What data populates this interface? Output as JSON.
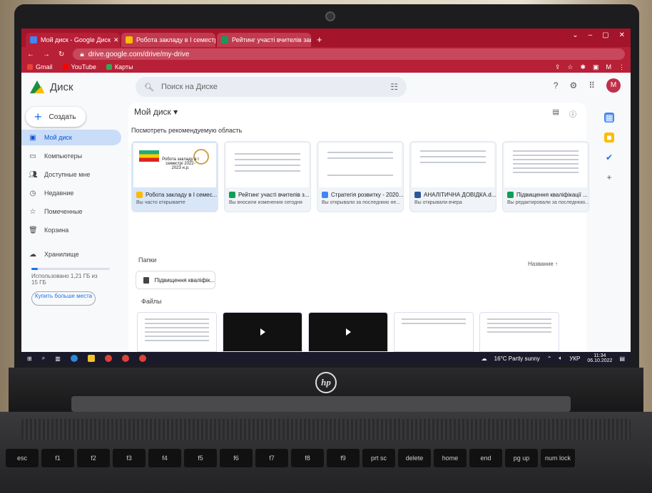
{
  "browser": {
    "tabs": [
      {
        "label": "Мой диск - Google Диск",
        "icon": "google-drive-icon",
        "color": "#4285f4"
      },
      {
        "label": "Робота закладу в I семестрі 20...",
        "icon": "slides-icon",
        "color": "#fbbc04"
      },
      {
        "label": "Рейтинг участі вчителів заклад...",
        "icon": "sheets-icon",
        "color": "#0f9d58"
      }
    ],
    "url": "drive.google.com/drive/my-drive",
    "bookmarks": [
      {
        "label": "Gmail",
        "color": "#ea4335"
      },
      {
        "label": "YouTube",
        "color": "#ff0000"
      },
      {
        "label": "Карты",
        "color": "#34a853"
      }
    ],
    "accent": "#b82037"
  },
  "drive": {
    "logo_text": "Диск",
    "search_placeholder": "Поиск на Диске",
    "avatar_letter": "M",
    "new_button": "Создать",
    "nav": [
      {
        "label": "Мой диск",
        "icon": "drive-icon"
      },
      {
        "label": "Компьютеры",
        "icon": "computer-icon"
      },
      {
        "label": "Доступные мне",
        "icon": "shared-icon"
      },
      {
        "label": "Недавние",
        "icon": "clock-icon"
      },
      {
        "label": "Помеченные",
        "icon": "star-icon"
      },
      {
        "label": "Корзина",
        "icon": "trash-icon"
      }
    ],
    "storage_label": "Хранилище",
    "storage_usage": "Использовано 1,21 ГБ из 15 ГБ",
    "storage_fraction": 0.08,
    "buy_button": "Купить больше места",
    "breadcrumb": "Мой диск",
    "recommended_label": "Посмотреть рекомендуемую область",
    "recommended": [
      {
        "name": "Робота закладу в I семес...",
        "sub": "Вы часто открываете",
        "type": "slides",
        "color": "#fbbc04",
        "thumb_title": "Робота закладу в I семестрі 2022-2023 н.р."
      },
      {
        "name": "Рейтинг участі вчителів з...",
        "sub": "Вы вносили изменения сегодня",
        "type": "sheets",
        "color": "#0f9d58"
      },
      {
        "name": "Стратегія розвитку - 2020...",
        "sub": "Вы открывали за последнюю не...",
        "type": "docs",
        "color": "#4285f4"
      },
      {
        "name": "АНАЛІТИЧНА ДОВІДКА.d...",
        "sub": "Вы открывали вчера",
        "type": "word",
        "color": "#2b579a"
      },
      {
        "name": "Підвищення кваліфікації ...",
        "sub": "Вы редактировали за последнюю...",
        "type": "sheets",
        "color": "#0f9d58"
      }
    ],
    "folders_label": "Папки",
    "sort_label": "Название",
    "folders": [
      {
        "name": "Підвищення кваліфік..."
      }
    ],
    "files_label": "Файлы",
    "files": [
      {
        "kind": "doc"
      },
      {
        "kind": "video"
      },
      {
        "kind": "video"
      },
      {
        "kind": "doc"
      },
      {
        "kind": "doc"
      }
    ]
  },
  "taskbar": {
    "weather": "16°C Partly sunny",
    "lang": "УКР",
    "time": "11:34",
    "date": "06.10.2022"
  },
  "laptop": {
    "brand": "hp"
  },
  "keyboard": [
    "esc",
    "f1",
    "f2",
    "f3",
    "f4",
    "f5",
    "f6",
    "f7",
    "f8",
    "f9",
    "prt sc",
    "delete",
    "home",
    "end",
    "pg up",
    "num lock"
  ]
}
